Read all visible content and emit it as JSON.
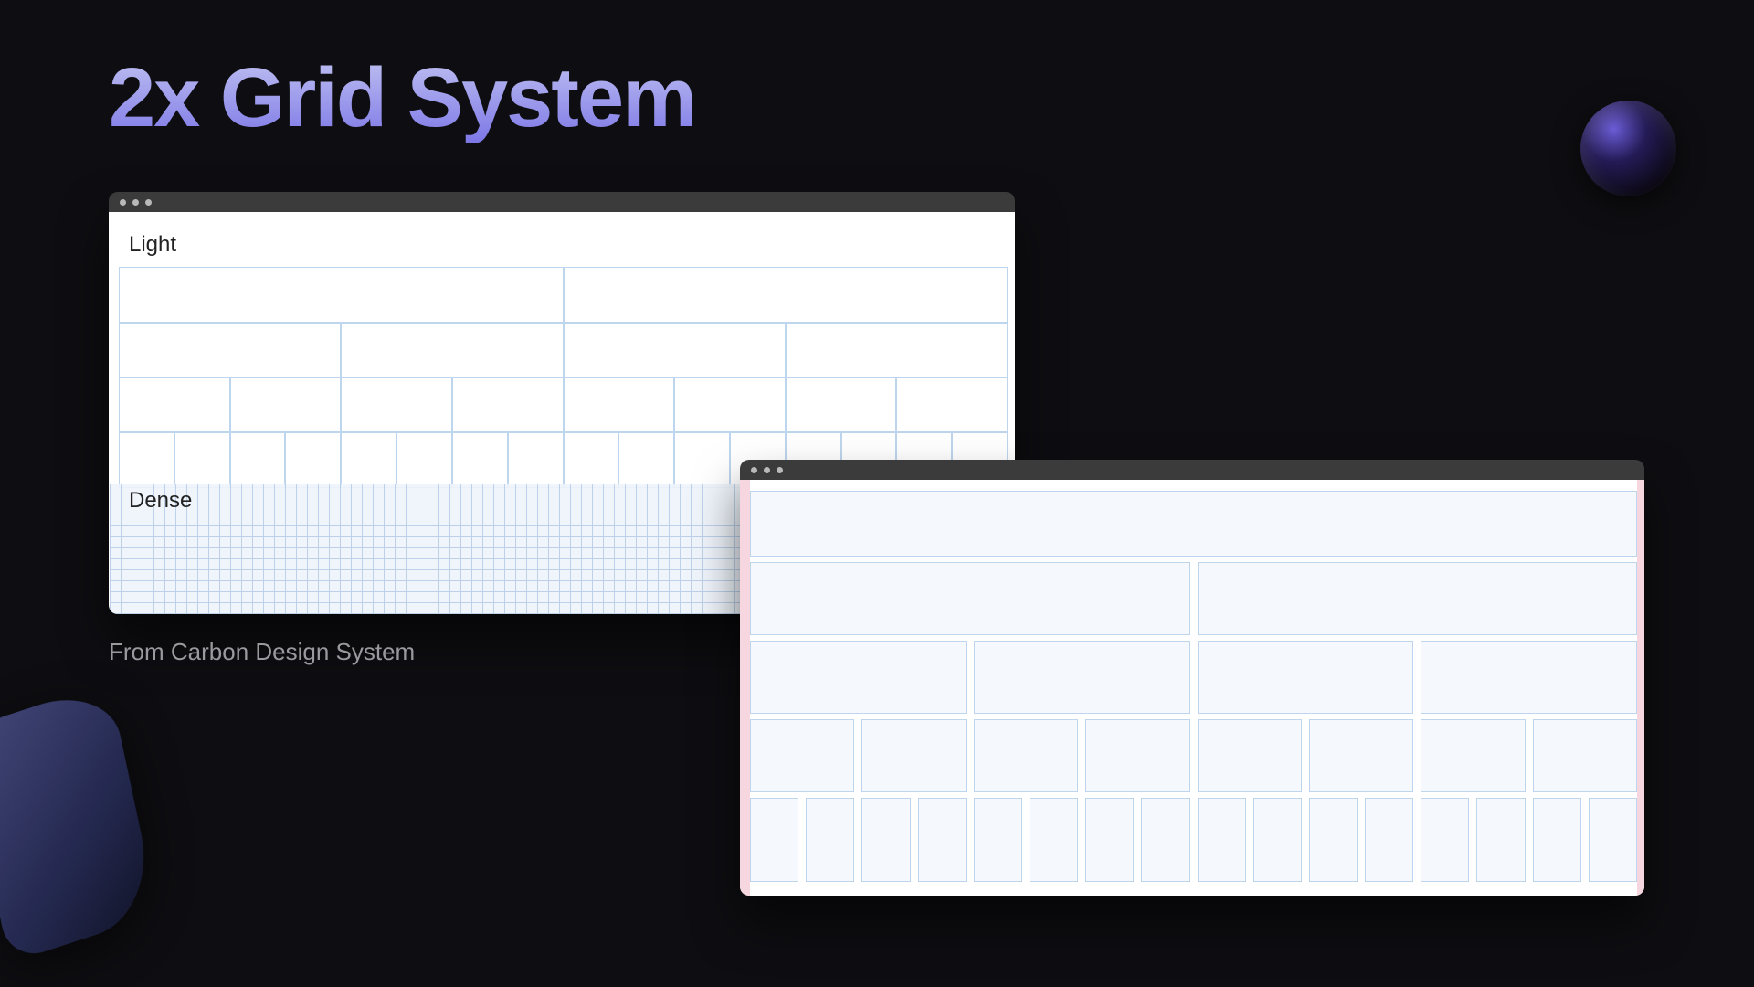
{
  "title": "2x Grid System",
  "caption": "From Carbon Design System",
  "labels": {
    "light": "Light",
    "dense": "Dense"
  },
  "grid": {
    "windowA_light_rows_columns": [
      2,
      4,
      8,
      16
    ],
    "windowB_rows_columns": [
      1,
      2,
      4,
      8,
      16
    ]
  }
}
